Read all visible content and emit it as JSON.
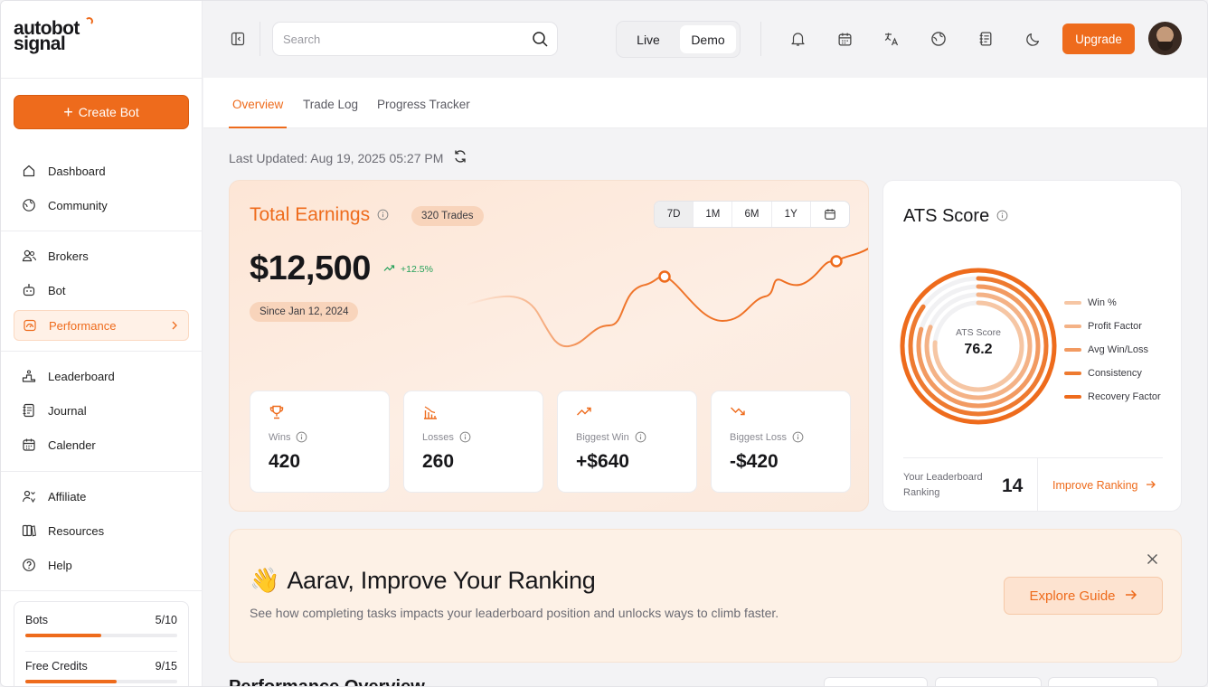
{
  "brand": {
    "line1": "autobot",
    "line2": "signal",
    "accent": "#ee6b1c"
  },
  "sidebar": {
    "create_label": "Create Bot",
    "groups": [
      [
        {
          "label": "Dashboard",
          "icon": "home-icon"
        },
        {
          "label": "Community",
          "icon": "globe-icon"
        }
      ],
      [
        {
          "label": "Brokers",
          "icon": "users-icon"
        },
        {
          "label": "Bot",
          "icon": "bot-icon"
        },
        {
          "label": "Performance",
          "icon": "gauge-icon",
          "active": true
        }
      ],
      [
        {
          "label": "Leaderboard",
          "icon": "podium-icon"
        },
        {
          "label": "Journal",
          "icon": "journal-icon"
        },
        {
          "label": "Calender",
          "icon": "calendar-icon"
        }
      ],
      [
        {
          "label": "Affiliate",
          "icon": "affiliate-icon"
        },
        {
          "label": "Resources",
          "icon": "book-icon"
        },
        {
          "label": "Help",
          "icon": "help-icon"
        }
      ]
    ],
    "usage": [
      {
        "label": "Bots",
        "value": "5/10",
        "fraction": 0.5
      },
      {
        "label": "Free Credits",
        "value": "9/15",
        "fraction": 0.6
      }
    ]
  },
  "header": {
    "search_placeholder": "Search",
    "modes": [
      "Live",
      "Demo"
    ],
    "selected_mode": "Demo",
    "icons": [
      "bell-icon",
      "calendar-icon",
      "translate-icon",
      "globe-icon",
      "journal-icon",
      "moon-icon"
    ],
    "upgrade_label": "Upgrade"
  },
  "tabs": [
    "Overview",
    "Trade Log",
    "Progress Tracker"
  ],
  "selected_tab": "Overview",
  "last_updated": "Last Updated: Aug 19, 2025 05:27 PM",
  "earnings": {
    "title": "Total Earnings",
    "trades_badge": "320 Trades",
    "ranges": [
      "7D",
      "1M",
      "6M",
      "1Y"
    ],
    "selected_range": "7D",
    "amount": "$12,500",
    "change": "+12.5%",
    "since": "Since Jan 12, 2024",
    "stats": [
      {
        "label": "Wins",
        "value": "420",
        "icon": "trophy-icon"
      },
      {
        "label": "Losses",
        "value": "260",
        "icon": "bar-down-icon"
      },
      {
        "label": "Biggest Win",
        "value": "+$640",
        "icon": "trend-up-icon"
      },
      {
        "label": "Biggest Loss",
        "value": "-$420",
        "icon": "trend-down-icon"
      }
    ]
  },
  "ats": {
    "title": "ATS Score",
    "center_label": "ATS Score",
    "center_value": "76.2",
    "legend": [
      {
        "label": "Win %",
        "color": "#f6c6a4"
      },
      {
        "label": "Profit Factor",
        "color": "#f4b286"
      },
      {
        "label": "Avg Win/Loss",
        "color": "#f29a61"
      },
      {
        "label": "Consistency",
        "color": "#ee7a30"
      },
      {
        "label": "Recovery Factor",
        "color": "#ee6b1c"
      }
    ],
    "rank_label": "Your Leaderboard Ranking",
    "rank_value": "14",
    "improve_label": "Improve Ranking"
  },
  "banner": {
    "emoji": "👋",
    "title": "Aarav, Improve Your Ranking",
    "subtitle": "See how completing tasks impacts your leaderboard position and unlocks ways to climb faster.",
    "button_label": "Explore Guide"
  },
  "next_section_title": "Performance Overview"
}
